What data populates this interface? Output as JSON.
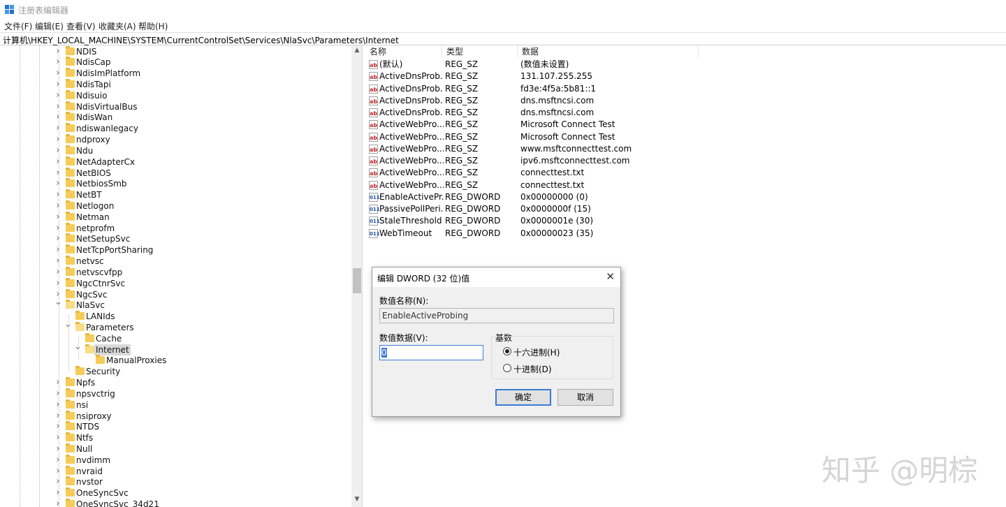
{
  "window": {
    "title": "注册表编辑器"
  },
  "menu": [
    "文件(F)",
    "编辑(E)",
    "查看(V)",
    "收藏夹(A)",
    "帮助(H)"
  ],
  "address": "计算机\\HKEY_LOCAL_MACHINE\\SYSTEM\\CurrentControlSet\\Services\\NlaSvc\\Parameters\\Internet",
  "tree": [
    {
      "label": "NDIS",
      "level": 0,
      "caret": "collapsed"
    },
    {
      "label": "NdisCap",
      "level": 0,
      "caret": "collapsed"
    },
    {
      "label": "NdisImPlatform",
      "level": 0,
      "caret": "collapsed"
    },
    {
      "label": "NdisTapi",
      "level": 0,
      "caret": "collapsed"
    },
    {
      "label": "Ndisuio",
      "level": 0,
      "caret": "collapsed"
    },
    {
      "label": "NdisVirtualBus",
      "level": 0,
      "caret": "collapsed"
    },
    {
      "label": "NdisWan",
      "level": 0,
      "caret": "collapsed"
    },
    {
      "label": "ndiswanlegacy",
      "level": 0,
      "caret": "collapsed"
    },
    {
      "label": "ndproxy",
      "level": 0,
      "caret": "collapsed"
    },
    {
      "label": "Ndu",
      "level": 0,
      "caret": "collapsed"
    },
    {
      "label": "NetAdapterCx",
      "level": 0,
      "caret": "collapsed"
    },
    {
      "label": "NetBIOS",
      "level": 0,
      "caret": "collapsed"
    },
    {
      "label": "NetbiosSmb",
      "level": 0,
      "caret": "collapsed"
    },
    {
      "label": "NetBT",
      "level": 0,
      "caret": "collapsed"
    },
    {
      "label": "Netlogon",
      "level": 0,
      "caret": "collapsed"
    },
    {
      "label": "Netman",
      "level": 0,
      "caret": "collapsed"
    },
    {
      "label": "netprofm",
      "level": 0,
      "caret": "collapsed"
    },
    {
      "label": "NetSetupSvc",
      "level": 0,
      "caret": "collapsed"
    },
    {
      "label": "NetTcpPortSharing",
      "level": 0,
      "caret": "collapsed"
    },
    {
      "label": "netvsc",
      "level": 0,
      "caret": "collapsed"
    },
    {
      "label": "netvscvfpp",
      "level": 0,
      "caret": "collapsed"
    },
    {
      "label": "NgcCtnrSvc",
      "level": 0,
      "caret": "collapsed"
    },
    {
      "label": "NgcSvc",
      "level": 0,
      "caret": "collapsed"
    },
    {
      "label": "NlaSvc",
      "level": 0,
      "caret": "expanded"
    },
    {
      "label": "LANIds",
      "level": 1,
      "caret": "none"
    },
    {
      "label": "Parameters",
      "level": 1,
      "caret": "expanded"
    },
    {
      "label": "Cache",
      "level": 2,
      "caret": "none"
    },
    {
      "label": "Internet",
      "level": 2,
      "caret": "expanded",
      "selected": true
    },
    {
      "label": "ManualProxies",
      "level": 3,
      "caret": "none"
    },
    {
      "label": "Security",
      "level": 1,
      "caret": "none"
    },
    {
      "label": "Npfs",
      "level": 0,
      "caret": "collapsed"
    },
    {
      "label": "npsvctrig",
      "level": 0,
      "caret": "collapsed"
    },
    {
      "label": "nsi",
      "level": 0,
      "caret": "collapsed"
    },
    {
      "label": "nsiproxy",
      "level": 0,
      "caret": "collapsed"
    },
    {
      "label": "NTDS",
      "level": 0,
      "caret": "collapsed"
    },
    {
      "label": "Ntfs",
      "level": 0,
      "caret": "collapsed"
    },
    {
      "label": "Null",
      "level": 0,
      "caret": "collapsed"
    },
    {
      "label": "nvdimm",
      "level": 0,
      "caret": "collapsed"
    },
    {
      "label": "nvraid",
      "level": 0,
      "caret": "collapsed"
    },
    {
      "label": "nvstor",
      "level": 0,
      "caret": "collapsed"
    },
    {
      "label": "OneSyncSvc",
      "level": 0,
      "caret": "collapsed"
    },
    {
      "label": "OneSyncSvc_34d21",
      "level": 0,
      "caret": "collapsed"
    }
  ],
  "values": {
    "columns": [
      "名称",
      "类型",
      "数据"
    ],
    "rows": [
      {
        "icon": "ab",
        "name": "(默认)",
        "type": "REG_SZ",
        "data": "(数值未设置)"
      },
      {
        "icon": "ab",
        "name": "ActiveDnsProb...",
        "type": "REG_SZ",
        "data": "131.107.255.255"
      },
      {
        "icon": "ab",
        "name": "ActiveDnsProb...",
        "type": "REG_SZ",
        "data": "fd3e:4f5a:5b81::1"
      },
      {
        "icon": "ab",
        "name": "ActiveDnsProb...",
        "type": "REG_SZ",
        "data": "dns.msftncsi.com"
      },
      {
        "icon": "ab",
        "name": "ActiveDnsProb...",
        "type": "REG_SZ",
        "data": "dns.msftncsi.com"
      },
      {
        "icon": "ab",
        "name": "ActiveWebPro...",
        "type": "REG_SZ",
        "data": "Microsoft Connect Test"
      },
      {
        "icon": "ab",
        "name": "ActiveWebPro...",
        "type": "REG_SZ",
        "data": "Microsoft Connect Test"
      },
      {
        "icon": "ab",
        "name": "ActiveWebPro...",
        "type": "REG_SZ",
        "data": "www.msftconnecttest.com"
      },
      {
        "icon": "ab",
        "name": "ActiveWebPro...",
        "type": "REG_SZ",
        "data": "ipv6.msftconnecttest.com"
      },
      {
        "icon": "ab",
        "name": "ActiveWebPro...",
        "type": "REG_SZ",
        "data": "connecttest.txt"
      },
      {
        "icon": "ab",
        "name": "ActiveWebPro...",
        "type": "REG_SZ",
        "data": "connecttest.txt"
      },
      {
        "icon": "dword",
        "name": "EnableActivePr...",
        "type": "REG_DWORD",
        "data": "0x00000000 (0)"
      },
      {
        "icon": "dword",
        "name": "PassivePollPeri...",
        "type": "REG_DWORD",
        "data": "0x0000000f (15)"
      },
      {
        "icon": "dword",
        "name": "StaleThreshold",
        "type": "REG_DWORD",
        "data": "0x0000001e (30)"
      },
      {
        "icon": "dword",
        "name": "WebTimeout",
        "type": "REG_DWORD",
        "data": "0x00000023 (35)"
      }
    ]
  },
  "dialog": {
    "title": "编辑 DWORD (32 位)值",
    "close_icon": "✕",
    "name_label": "数值名称(N):",
    "name_value": "EnableActiveProbing",
    "data_label": "数值数据(V):",
    "data_value": "0",
    "base_label": "基数",
    "hex_label": "十六进制(H)",
    "dec_label": "十进制(D)",
    "selected_base": "hex",
    "ok": "确定",
    "cancel": "取消"
  },
  "watermark": "知乎 @明棕",
  "colors": {
    "selection": "#d9d9d9",
    "focus_blue": "#3a7bd5",
    "folder": "#f5cc57"
  }
}
